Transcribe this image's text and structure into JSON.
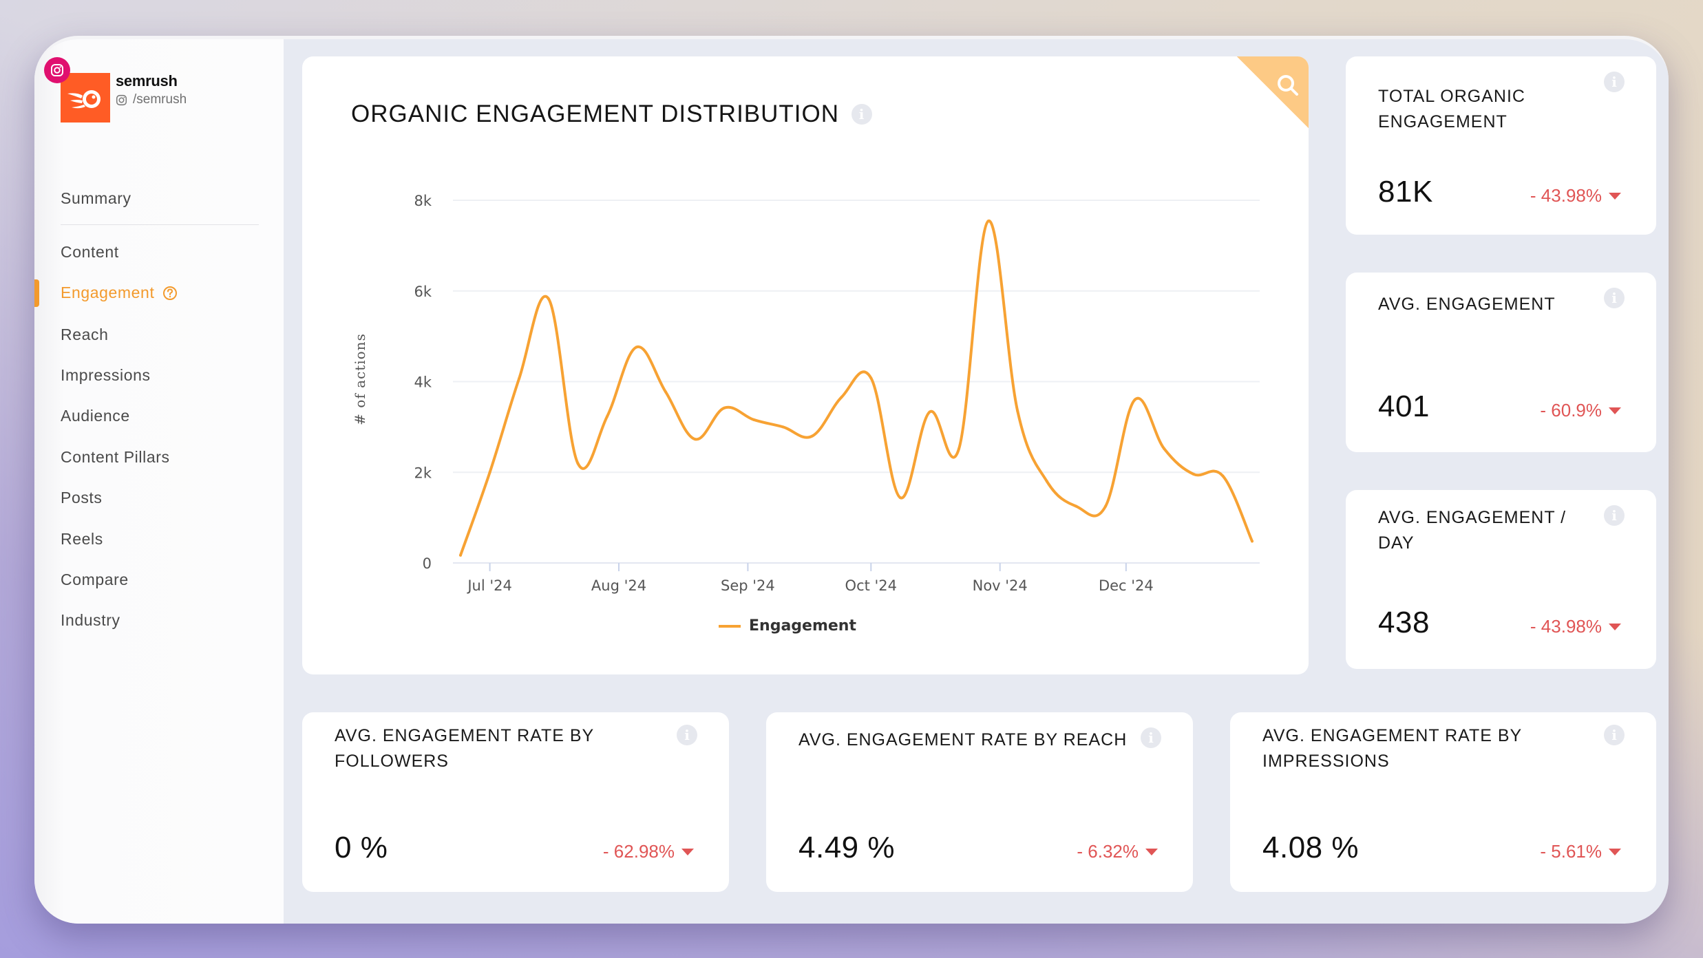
{
  "profile": {
    "name": "semrush",
    "handle": "/semrush",
    "platform": "instagram",
    "logo_icon": "semrush-comet-logo",
    "brand_color": "#ff5c25",
    "platform_color": "#e0106f"
  },
  "sidebar": {
    "items": [
      {
        "label": "Summary",
        "active": false
      },
      {
        "label": "Content",
        "active": false
      },
      {
        "label": "Engagement",
        "active": true,
        "help_icon": "question-circle-icon"
      },
      {
        "label": "Reach",
        "active": false
      },
      {
        "label": "Impressions",
        "active": false
      },
      {
        "label": "Audience",
        "active": false
      },
      {
        "label": "Content Pillars",
        "active": false
      },
      {
        "label": "Posts",
        "active": false
      },
      {
        "label": "Reels",
        "active": false
      },
      {
        "label": "Compare",
        "active": false
      },
      {
        "label": "Industry",
        "active": false
      }
    ],
    "accent_color": "#f39a2c"
  },
  "chart_card": {
    "title": "ORGANIC ENGAGEMENT DISTRIBUTION",
    "info_icon": "info-icon",
    "corner_icon": "search-icon"
  },
  "chart_data": {
    "type": "line",
    "title": "ORGANIC ENGAGEMENT DISTRIBUTION",
    "xlabel": "",
    "ylabel": "# of actions",
    "ylim": [
      0,
      8000
    ],
    "yticks": [
      0,
      2000,
      4000,
      6000,
      8000
    ],
    "ytick_labels": [
      "0",
      "2k",
      "4k",
      "6k",
      "8k"
    ],
    "xtick_labels": [
      "Jul '24",
      "Aug '24",
      "Sep '24",
      "Oct '24",
      "Nov '24",
      "Dec '24"
    ],
    "xtick_positions_week_index": [
      1.0,
      5.4,
      9.8,
      14.0,
      18.4,
      22.7
    ],
    "grid": true,
    "legend": "bottom-center",
    "color": "#f7a233",
    "series": [
      {
        "name": "Engagement",
        "x_week_index": [
          0,
          1,
          2,
          3,
          4,
          5,
          6,
          7,
          8,
          9,
          10,
          11,
          12,
          13,
          14,
          15,
          16,
          17,
          18,
          19,
          20,
          21,
          22,
          23,
          24,
          25,
          26,
          27
        ],
        "values": [
          170,
          2000,
          4070,
          5830,
          2200,
          3230,
          4760,
          3770,
          2730,
          3420,
          3160,
          3000,
          2800,
          3660,
          4080,
          1440,
          3330,
          2520,
          7540,
          3350,
          1800,
          1250,
          1250,
          3600,
          2520,
          1960,
          1920,
          480
        ]
      }
    ]
  },
  "stats_right": [
    {
      "title": "TOTAL ORGANIC ENGAGEMENT",
      "value": "81K",
      "change": "- 43.98%",
      "direction": "down"
    },
    {
      "title": "AVG. ENGAGEMENT",
      "value": "401",
      "change": "- 60.9%",
      "direction": "down"
    },
    {
      "title": "AVG. ENGAGEMENT / DAY",
      "value": "438",
      "change": "- 43.98%",
      "direction": "down"
    }
  ],
  "stats_bottom": [
    {
      "title": "AVG. ENGAGEMENT RATE BY FOLLOWERS",
      "value": "0 %",
      "change": "- 62.98%",
      "direction": "down"
    },
    {
      "title": "AVG. ENGAGEMENT RATE BY REACH",
      "value": "4.49 %",
      "change": "- 6.32%",
      "direction": "down"
    },
    {
      "title": "AVG. ENGAGEMENT RATE BY IMPRESSIONS",
      "value": "4.08 %",
      "change": "- 5.61%",
      "direction": "down"
    }
  ],
  "colors": {
    "negative": "#e05555",
    "line": "#f7a233",
    "corner_badge": "#fdca85"
  }
}
